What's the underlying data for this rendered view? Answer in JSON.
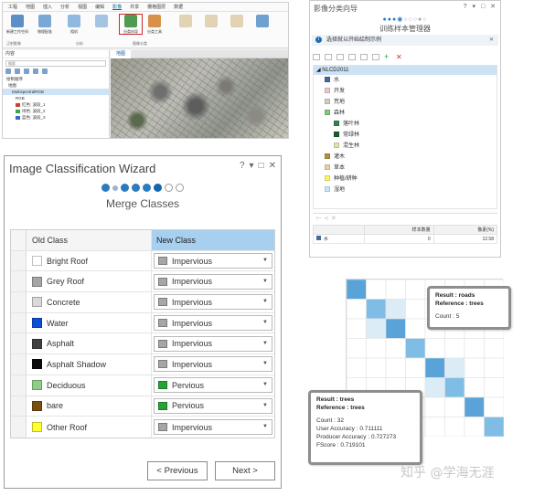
{
  "arcgis": {
    "menu": [
      "工程",
      "地图",
      "插入",
      "分析",
      "视图",
      "编辑",
      "影像",
      "共享",
      "栅格图层",
      "数据"
    ],
    "menu_active_index": 6,
    "ribbon_buttons": [
      "新建工作空间",
      "物理配准",
      "相机",
      "分类向导",
      "分类工具"
    ],
    "ribbon_groups": [
      "正射影像",
      "分析",
      "图像分类"
    ],
    "contents_title": "内容",
    "contents_search_placeholder": "搜索",
    "contents_rows": [
      "绘制顺序",
      "地图",
      "MultispectralRGB",
      "RGB",
      "红色: 波段_1",
      "绿色: 波段_2",
      "蓝色: 波段_3"
    ],
    "map_tab": "地图"
  },
  "training": {
    "title": "影像分类向导",
    "window_controls": "? ▾ □ ✕",
    "subtitle": "训练样本管理器",
    "info_text": "选择就以开始绘制示例",
    "root": "NLCD2011",
    "classes": [
      {
        "label": "水",
        "color": "#476ba1",
        "indent": 1
      },
      {
        "label": "开发",
        "color": "#e8c9d1",
        "indent": 1
      },
      {
        "label": "荒地",
        "color": "#d2cdc0",
        "indent": 1
      },
      {
        "label": "森林",
        "color": "#85c77e",
        "indent": 1
      },
      {
        "label": "落叶林",
        "color": "#38814e",
        "indent": 2
      },
      {
        "label": "常绿林",
        "color": "#1c5c2e",
        "indent": 2
      },
      {
        "label": "混生林",
        "color": "#d4e7b0",
        "indent": 2
      },
      {
        "label": "灌木",
        "color": "#af963c",
        "indent": 1
      },
      {
        "label": "草本",
        "color": "#e8d19e",
        "indent": 1
      },
      {
        "label": "种植/耕种",
        "color": "#fbf65d",
        "indent": 1
      },
      {
        "label": "湿地",
        "color": "#c8e6f8",
        "indent": 1
      }
    ],
    "table_headers": [
      "样本数量",
      "像素(%)"
    ],
    "table_rows": [
      {
        "label": "水",
        "count": "0",
        "pct": "12.58"
      }
    ]
  },
  "wizard": {
    "title": "Image Classification Wizard",
    "window_controls": [
      "?",
      "▾",
      "□",
      "✕"
    ],
    "step_title": "Merge Classes",
    "columns": {
      "old": "Old Class",
      "new": "New Class"
    },
    "rows": [
      {
        "old": "Bright Roof",
        "old_color": "#ffffff",
        "new": "Impervious",
        "new_color": "#a6a6a6"
      },
      {
        "old": "Grey Roof",
        "old_color": "#a6a6a6",
        "new": "Impervious",
        "new_color": "#a6a6a6"
      },
      {
        "old": "Concrete",
        "old_color": "#d9d9d9",
        "new": "Impervious",
        "new_color": "#a6a6a6"
      },
      {
        "old": "Water",
        "old_color": "#0b4fd6",
        "new": "Impervious",
        "new_color": "#a6a6a6"
      },
      {
        "old": "Asphalt",
        "old_color": "#404040",
        "new": "Impervious",
        "new_color": "#a6a6a6"
      },
      {
        "old": "Asphalt Shadow",
        "old_color": "#0d0d0d",
        "new": "Impervious",
        "new_color": "#a6a6a6"
      },
      {
        "old": "Deciduous",
        "old_color": "#8fce8a",
        "new": "Pervious",
        "new_color": "#25a336"
      },
      {
        "old": "bare",
        "old_color": "#7a4e0f",
        "new": "Pervious",
        "new_color": "#25a336"
      },
      {
        "old": "Other Roof",
        "old_color": "#ffff33",
        "new": "Impervious",
        "new_color": "#a6a6a6"
      }
    ],
    "buttons": {
      "previous": "< Previous",
      "next": "Next >"
    }
  },
  "matrix": {
    "tooltip_roads": {
      "result": "Result : roads",
      "reference": "Reference : trees",
      "count": "Count : 5"
    },
    "tooltip_trees": {
      "result": "Result : trees",
      "reference": "Reference : trees",
      "count": "Count : 32",
      "user_accuracy": "User Accuracy : 0.711111",
      "producer_accuracy": "Producer Accuracy : 0.727273",
      "fscore": "FScore : 0.719101"
    }
  },
  "watermark": "知乎 @学海无涯"
}
